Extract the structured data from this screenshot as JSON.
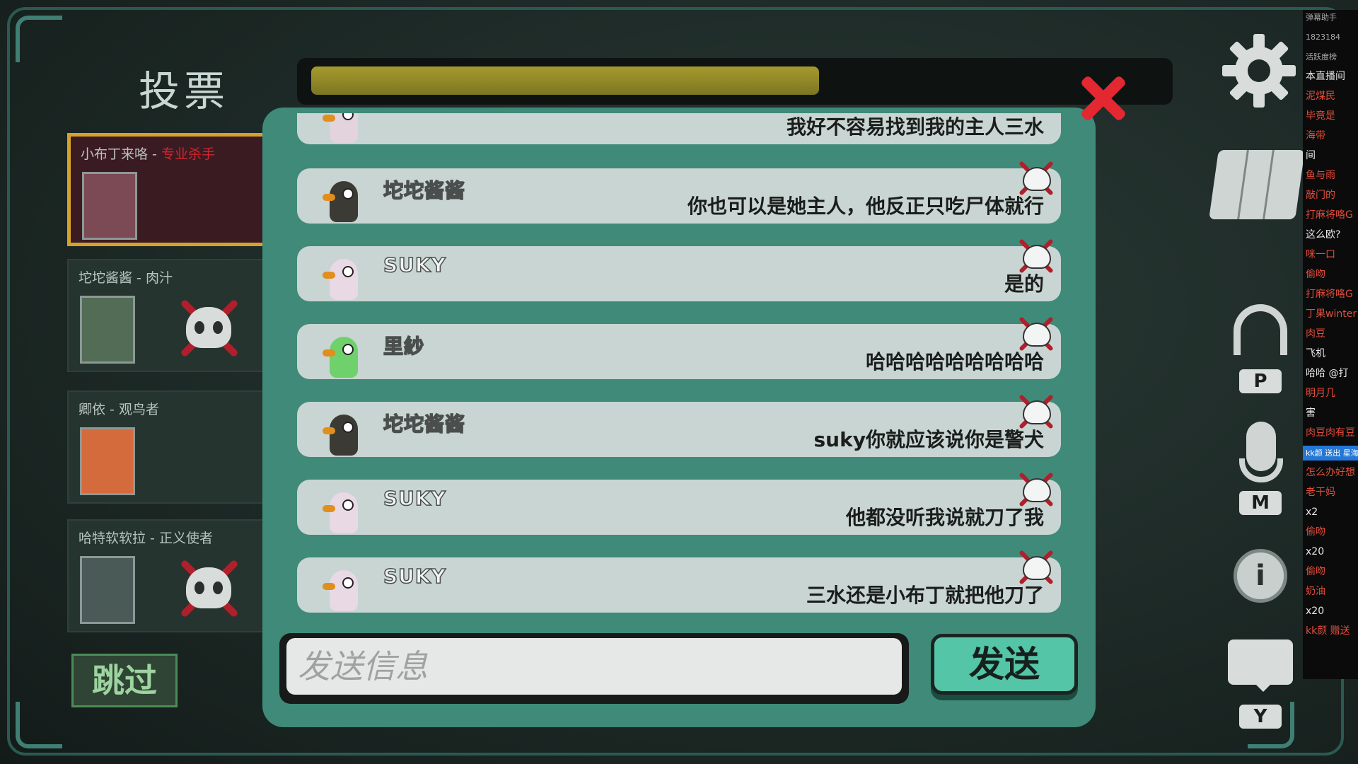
{
  "vote_title": "投票",
  "timer": {
    "fill_fraction": 0.5
  },
  "players": [
    {
      "name": "小布丁来咯",
      "separator": " - ",
      "role": "专业杀手",
      "active": true,
      "dead": false,
      "color": "#7c4a54"
    },
    {
      "name": "坨坨酱酱",
      "separator": " - ",
      "role": "肉汁",
      "active": false,
      "dead": true,
      "color": "#536c55"
    },
    {
      "name": "卿依",
      "separator": " - ",
      "role": "观鸟者",
      "active": false,
      "dead": false,
      "color": "#d46b3c"
    },
    {
      "name": "哈特软软拉",
      "separator": " - ",
      "role": "正义使者",
      "active": false,
      "dead": true,
      "color": "#4a5b57"
    }
  ],
  "skip_label": "跳过",
  "messages": [
    {
      "name": "",
      "text": "我好不容易找到我的主人三水",
      "avatar_color": "#e2d3dc"
    },
    {
      "name": "坨坨酱酱",
      "text": "你也可以是她主人，他反正只吃尸体就行",
      "avatar_color": "#3c3a35"
    },
    {
      "name": "SUKY",
      "text": "是的",
      "avatar_color": "#e8d9e4"
    },
    {
      "name": "里紗",
      "text": "哈哈哈哈哈哈哈哈哈",
      "avatar_color": "#6fd16b"
    },
    {
      "name": "坨坨酱酱",
      "text": "suky你就应该说你是警犬",
      "avatar_color": "#3c3a35"
    },
    {
      "name": "SUKY",
      "text": "他都没听我说就刀了我",
      "avatar_color": "#e8d9e4"
    },
    {
      "name": "SUKY",
      "text": "三水还是小布丁就把他刀了",
      "avatar_color": "#e8d9e4"
    }
  ],
  "chat_input": {
    "placeholder": "发送信息",
    "value": ""
  },
  "send_label": "发送",
  "keys": {
    "headset": "P",
    "mic": "M",
    "chat": "Y"
  },
  "info_symbol": "i",
  "stream": [
    {
      "text": "弹幕助手",
      "style": "small"
    },
    {
      "text": "1823184",
      "style": "small"
    },
    {
      "text": "活跃度榜",
      "style": "small"
    },
    {
      "text": "本直播间",
      "style": "normal"
    },
    {
      "text": "泥煤民",
      "style": "accent"
    },
    {
      "text": "毕竟是",
      "style": "accent"
    },
    {
      "text": "海带",
      "style": "accent"
    },
    {
      "text": "间",
      "style": "normal"
    },
    {
      "text": "鱼与雨",
      "style": "accent"
    },
    {
      "text": "敲门的",
      "style": "accent"
    },
    {
      "text": "打麻将咯G",
      "style": "accent"
    },
    {
      "text": "这么欧?",
      "style": "normal"
    },
    {
      "text": "咪一口",
      "style": "accent"
    },
    {
      "text": "偷吻",
      "style": "accent"
    },
    {
      "text": "打麻将咯G",
      "style": "accent"
    },
    {
      "text": "丁果winter",
      "style": "accent"
    },
    {
      "text": "肉豆",
      "style": "accent"
    },
    {
      "text": "飞机",
      "style": "normal"
    },
    {
      "text": "哈哈 @打",
      "style": "normal"
    },
    {
      "text": "明月几",
      "style": "accent"
    },
    {
      "text": "害",
      "style": "normal"
    },
    {
      "text": "肉豆肉有豆",
      "style": "accent"
    },
    {
      "text": "kk颜 送出 星海探索",
      "style": "gift"
    },
    {
      "text": "怎么办好想",
      "style": "accent"
    },
    {
      "text": "老干妈",
      "style": "accent"
    },
    {
      "text": "x2",
      "style": "normal"
    },
    {
      "text": "偷吻",
      "style": "accent"
    },
    {
      "text": "x20",
      "style": "normal"
    },
    {
      "text": "偷吻",
      "style": "accent"
    },
    {
      "text": "奶油",
      "style": "accent"
    },
    {
      "text": "x20",
      "style": "normal"
    },
    {
      "text": "kk颜 赠送",
      "style": "accent"
    }
  ]
}
